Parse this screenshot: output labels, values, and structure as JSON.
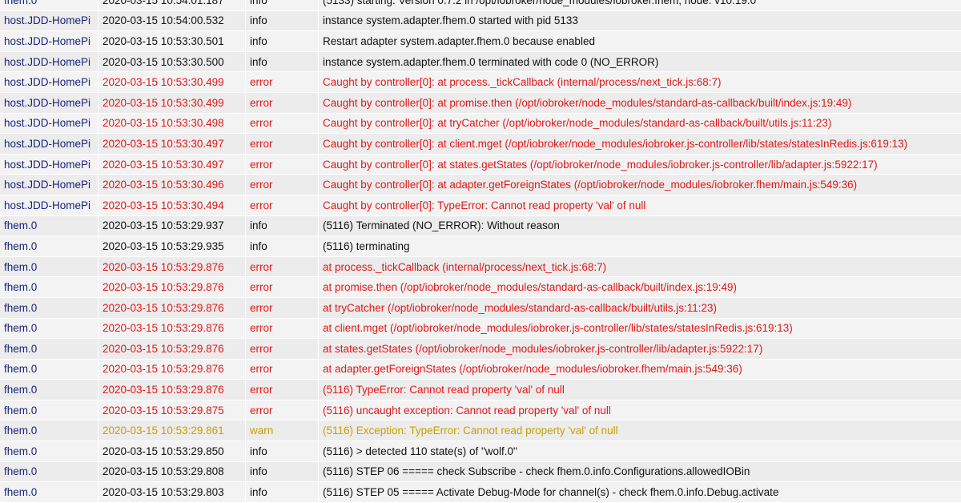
{
  "rows": [
    {
      "source": "fhem.0",
      "time": "2020-03-15 10:54:01.187",
      "severity": "info",
      "message": "(5133) starting. Version 0.7.2 in /opt/iobroker/node_modules/iobroker.fhem, node: v10.19.0"
    },
    {
      "source": "host.JDD-HomePi",
      "time": "2020-03-15 10:54:00.532",
      "severity": "info",
      "message": "instance system.adapter.fhem.0 started with pid 5133"
    },
    {
      "source": "host.JDD-HomePi",
      "time": "2020-03-15 10:53:30.501",
      "severity": "info",
      "message": "Restart adapter system.adapter.fhem.0 because enabled"
    },
    {
      "source": "host.JDD-HomePi",
      "time": "2020-03-15 10:53:30.500",
      "severity": "info",
      "message": "instance system.adapter.fhem.0 terminated with code 0 (NO_ERROR)"
    },
    {
      "source": "host.JDD-HomePi",
      "time": "2020-03-15 10:53:30.499",
      "severity": "error",
      "message": "Caught by controller[0]: at process._tickCallback (internal/process/next_tick.js:68:7)"
    },
    {
      "source": "host.JDD-HomePi",
      "time": "2020-03-15 10:53:30.499",
      "severity": "error",
      "message": "Caught by controller[0]: at promise.then (/opt/iobroker/node_modules/standard-as-callback/built/index.js:19:49)"
    },
    {
      "source": "host.JDD-HomePi",
      "time": "2020-03-15 10:53:30.498",
      "severity": "error",
      "message": "Caught by controller[0]: at tryCatcher (/opt/iobroker/node_modules/standard-as-callback/built/utils.js:11:23)"
    },
    {
      "source": "host.JDD-HomePi",
      "time": "2020-03-15 10:53:30.497",
      "severity": "error",
      "message": "Caught by controller[0]: at client.mget (/opt/iobroker/node_modules/iobroker.js-controller/lib/states/statesInRedis.js:619:13)"
    },
    {
      "source": "host.JDD-HomePi",
      "time": "2020-03-15 10:53:30.497",
      "severity": "error",
      "message": "Caught by controller[0]: at states.getStates (/opt/iobroker/node_modules/iobroker.js-controller/lib/adapter.js:5922:17)"
    },
    {
      "source": "host.JDD-HomePi",
      "time": "2020-03-15 10:53:30.496",
      "severity": "error",
      "message": "Caught by controller[0]: at adapter.getForeignStates (/opt/iobroker/node_modules/iobroker.fhem/main.js:549:36)"
    },
    {
      "source": "host.JDD-HomePi",
      "time": "2020-03-15 10:53:30.494",
      "severity": "error",
      "message": "Caught by controller[0]: TypeError: Cannot read property 'val' of null"
    },
    {
      "source": "fhem.0",
      "time": "2020-03-15 10:53:29.937",
      "severity": "info",
      "message": "(5116) Terminated (NO_ERROR): Without reason"
    },
    {
      "source": "fhem.0",
      "time": "2020-03-15 10:53:29.935",
      "severity": "info",
      "message": "(5116) terminating"
    },
    {
      "source": "fhem.0",
      "time": "2020-03-15 10:53:29.876",
      "severity": "error",
      "message": "at process._tickCallback (internal/process/next_tick.js:68:7)"
    },
    {
      "source": "fhem.0",
      "time": "2020-03-15 10:53:29.876",
      "severity": "error",
      "message": "at promise.then (/opt/iobroker/node_modules/standard-as-callback/built/index.js:19:49)"
    },
    {
      "source": "fhem.0",
      "time": "2020-03-15 10:53:29.876",
      "severity": "error",
      "message": "at tryCatcher (/opt/iobroker/node_modules/standard-as-callback/built/utils.js:11:23)"
    },
    {
      "source": "fhem.0",
      "time": "2020-03-15 10:53:29.876",
      "severity": "error",
      "message": "at client.mget (/opt/iobroker/node_modules/iobroker.js-controller/lib/states/statesInRedis.js:619:13)"
    },
    {
      "source": "fhem.0",
      "time": "2020-03-15 10:53:29.876",
      "severity": "error",
      "message": "at states.getStates (/opt/iobroker/node_modules/iobroker.js-controller/lib/adapter.js:5922:17)"
    },
    {
      "source": "fhem.0",
      "time": "2020-03-15 10:53:29.876",
      "severity": "error",
      "message": "at adapter.getForeignStates (/opt/iobroker/node_modules/iobroker.fhem/main.js:549:36)"
    },
    {
      "source": "fhem.0",
      "time": "2020-03-15 10:53:29.876",
      "severity": "error",
      "message": "(5116) TypeError: Cannot read property 'val' of null"
    },
    {
      "source": "fhem.0",
      "time": "2020-03-15 10:53:29.875",
      "severity": "error",
      "message": "(5116) uncaught exception: Cannot read property 'val' of null"
    },
    {
      "source": "fhem.0",
      "time": "2020-03-15 10:53:29.861",
      "severity": "warn",
      "message": "(5116) Exception: TypeError: Cannot read property 'val' of null"
    },
    {
      "source": "fhem.0",
      "time": "2020-03-15 10:53:29.850",
      "severity": "info",
      "message": "(5116) > detected 110 state(s) of \"wolf.0\""
    },
    {
      "source": "fhem.0",
      "time": "2020-03-15 10:53:29.808",
      "severity": "info",
      "message": "(5116) STEP 06 ===== check Subscribe - check fhem.0.info.Configurations.allowedIOBin"
    },
    {
      "source": "fhem.0",
      "time": "2020-03-15 10:53:29.803",
      "severity": "info",
      "message": "(5116) STEP 05 ===== Activate Debug-Mode for channel(s) - check fhem.0.info.Debug.activate"
    }
  ]
}
